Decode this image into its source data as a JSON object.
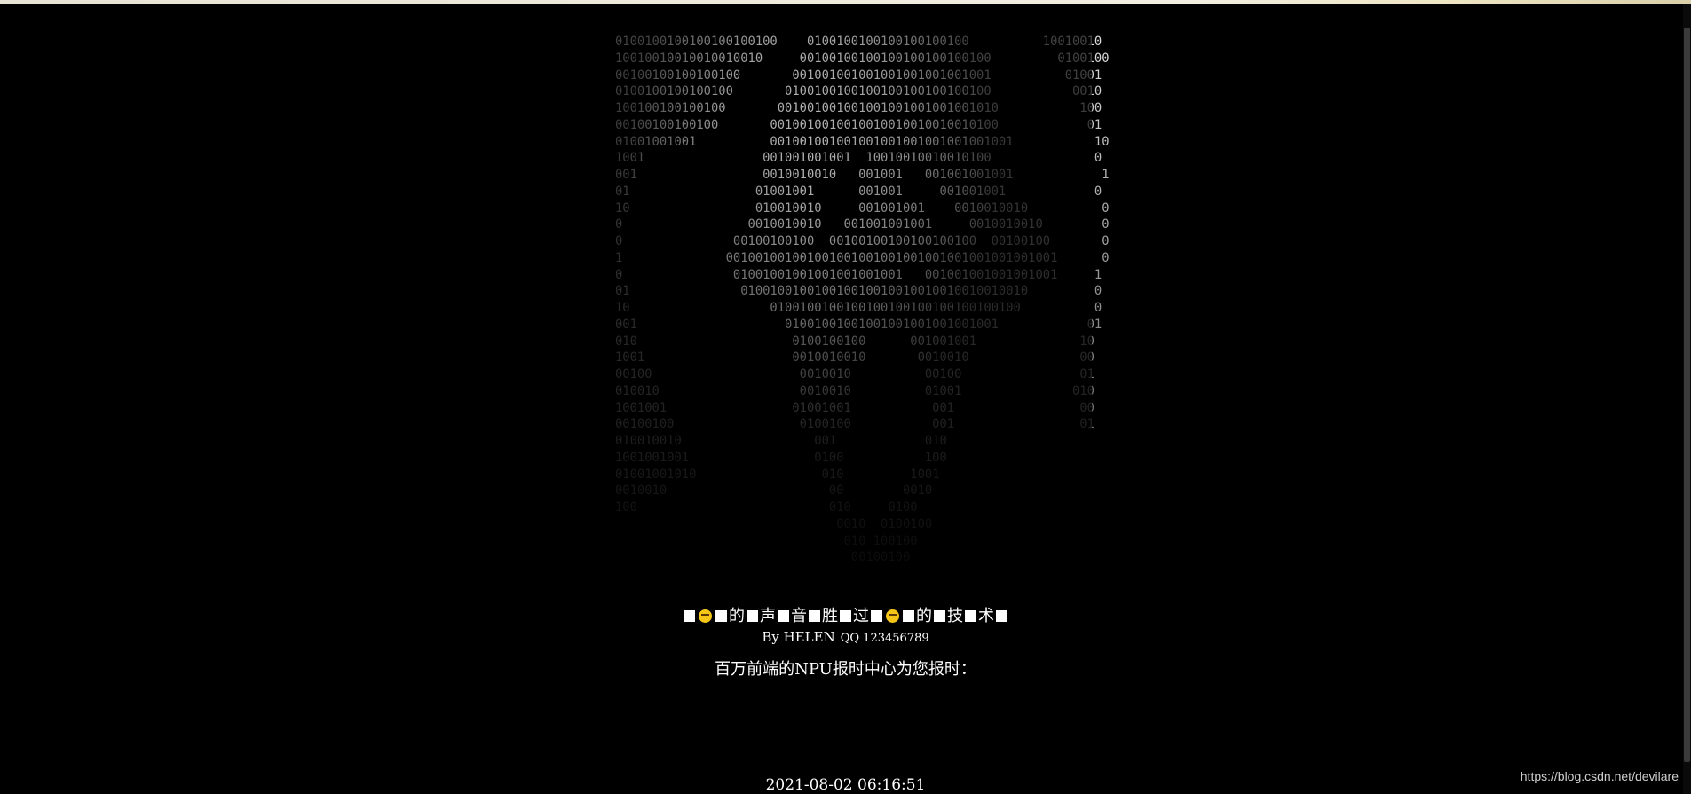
{
  "ascii_art": {
    "lines": [
      "0100100100100100100100    0100100100100100100100          10010010",
      "10010010010010010010     00100100100100100100100100         0100100",
      "00100100100100100       001001001001001001001001001          01001",
      "0100100100100100       0100100100100100100100100100           0010",
      "100100100100100       001001001001001001001001001010           100",
      "00100100100100       0010010010010010010010010010100            01",
      "01001001001          001001001001001001001001001001001           10",
      "1001                001001001001  10010010010010100              0",
      "001                 0010010010   001001   001001001001            1",
      "01                 01001001      001001     001001001            0",
      "10                 010010010     001001001    0010010010          0",
      "0                 0010010010   001001001001     0010010010        0",
      "0               00100100100  00100100100100100100  00100100       0",
      "1              001001001001001001001001001001001001001001001      0",
      "0               01001001001001001001001   001001001001001001     1",
      "01               010010010010010010010010010010010010010         0",
      "10                   0100100100100100100100100100100100          0",
      "001                    01001001001001001001001001001            01",
      "010                     0100100100      001001001              10",
      "1001                    0010010010       0010010               00",
      "00100                    0010010          00100                01",
      "010010                   0010010          01001               010",
      "1001001                 01001001           001                 00",
      "00100100                 0100100           001                 01",
      "010010010                  001            010",
      "1001001001                 0100           100",
      "01001001010                 010         1001",
      "0010010                      00        0010",
      "100                          010     0100",
      "                              0010  0100100",
      "                               010 100100",
      "                                00100100"
    ]
  },
  "title": {
    "words": [
      "的",
      "声",
      "音",
      "胜",
      "过",
      "的",
      "技",
      "术"
    ]
  },
  "byline": {
    "author": "By HELEN",
    "qq": "QQ 123456789"
  },
  "report_label": "百万前端的NPU报时中心为您报时：",
  "clock": "2021-08-02 06:16:51",
  "watermark": "https://blog.csdn.net/devilare"
}
